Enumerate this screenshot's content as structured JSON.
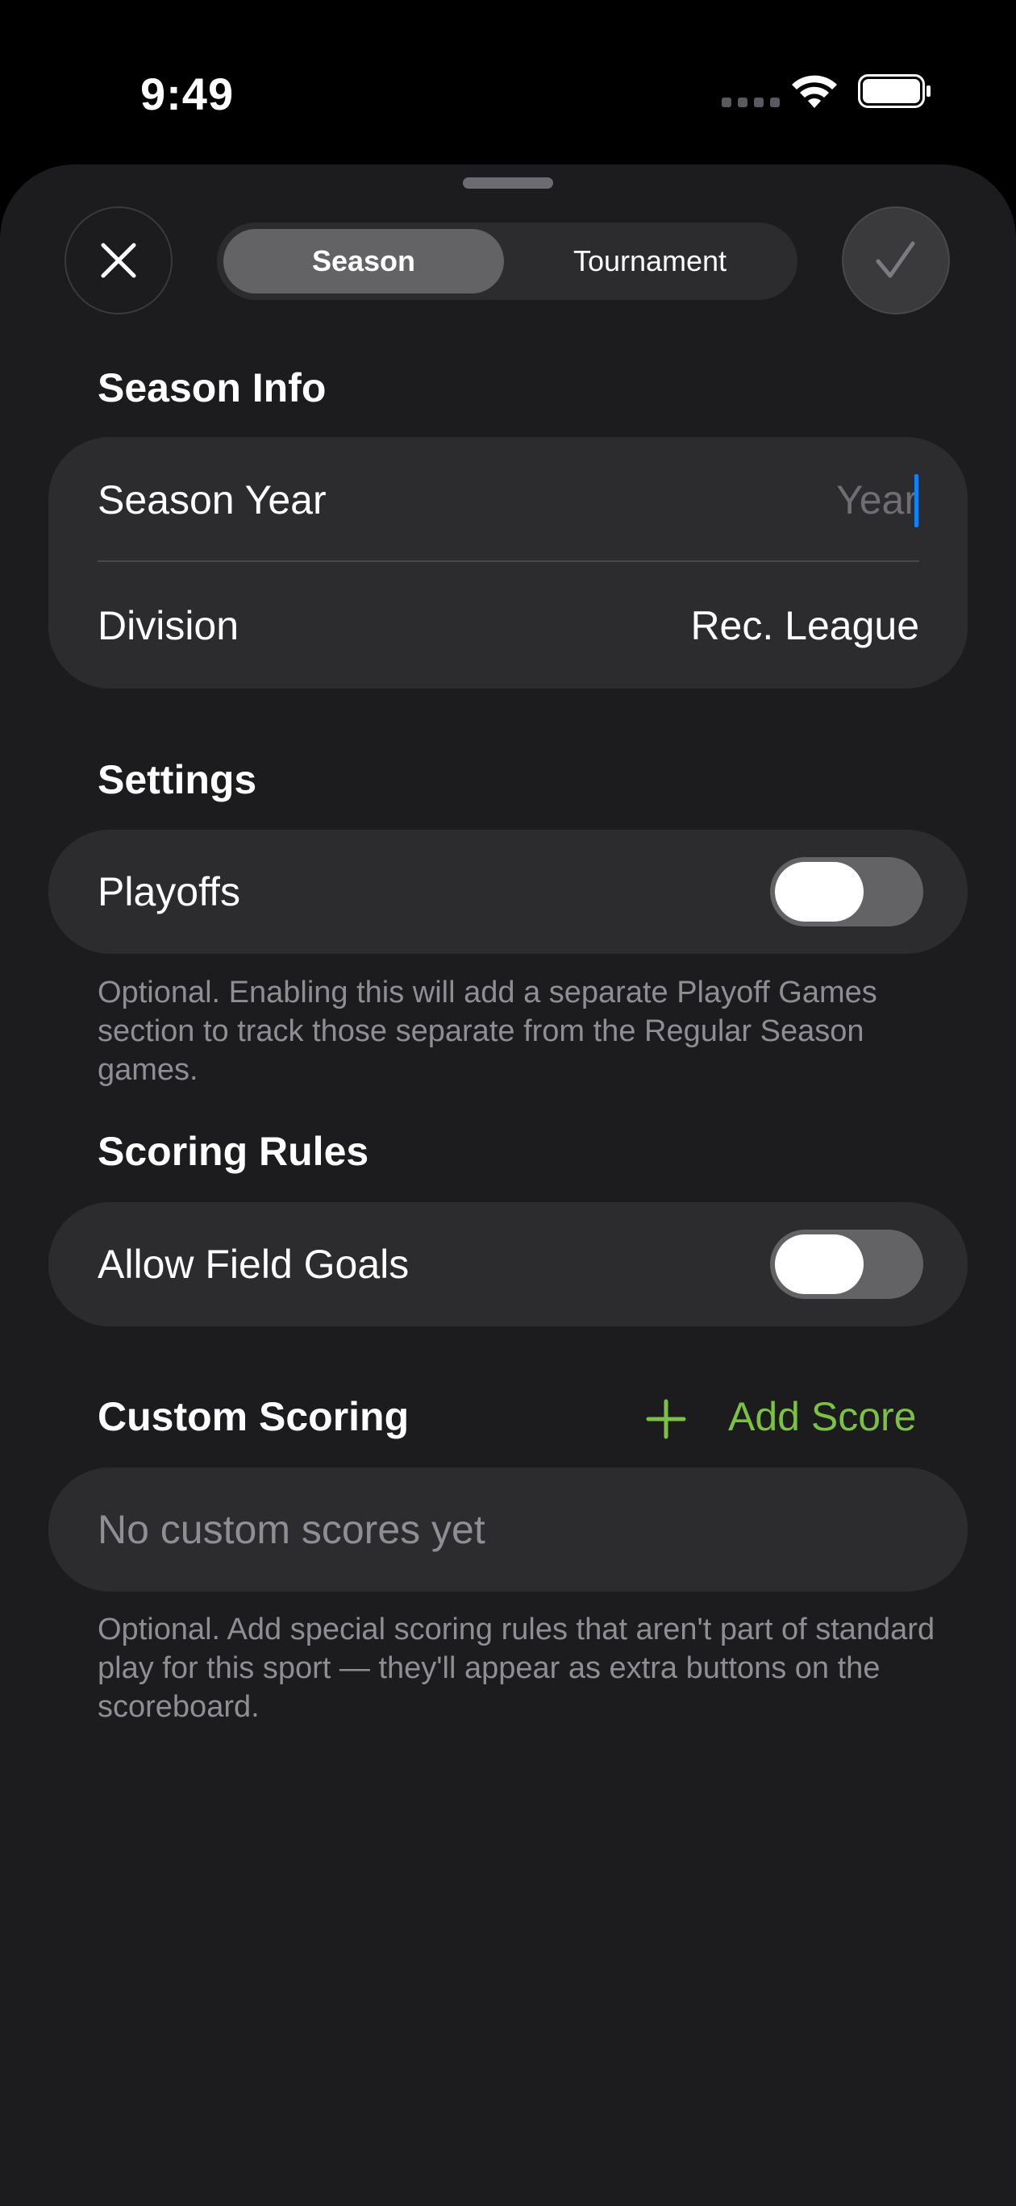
{
  "status": {
    "time": "9:49"
  },
  "header": {
    "segments": [
      "Season",
      "Tournament"
    ],
    "selected_segment": "Season",
    "close_icon": "close-icon",
    "confirm_icon": "checkmark-icon"
  },
  "season_info": {
    "title": "Season Info",
    "season_year_label": "Season Year",
    "season_year_placeholder": "Year",
    "division_label": "Division",
    "division_value": "Rec. League"
  },
  "settings": {
    "title": "Settings",
    "playoffs_label": "Playoffs",
    "playoffs_enabled": false,
    "note": "Optional. Enabling this will add a separate Playoff Games section to track those separate from the Regular Season games."
  },
  "scoring_rules": {
    "title": "Scoring Rules",
    "field_goals_label": "Allow Field Goals",
    "field_goals_enabled": false
  },
  "custom_scoring": {
    "title": "Custom Scoring",
    "add_label": "Add Score",
    "empty_text": "No custom scores yet",
    "note": "Optional. Add special scoring rules that aren't part of standard play for this sport — they'll appear as extra buttons on the scoreboard."
  },
  "colors": {
    "accent": "#7cc242",
    "cursor": "#0a84ff",
    "background": "#1c1c1e",
    "card": "#2c2c2e"
  }
}
